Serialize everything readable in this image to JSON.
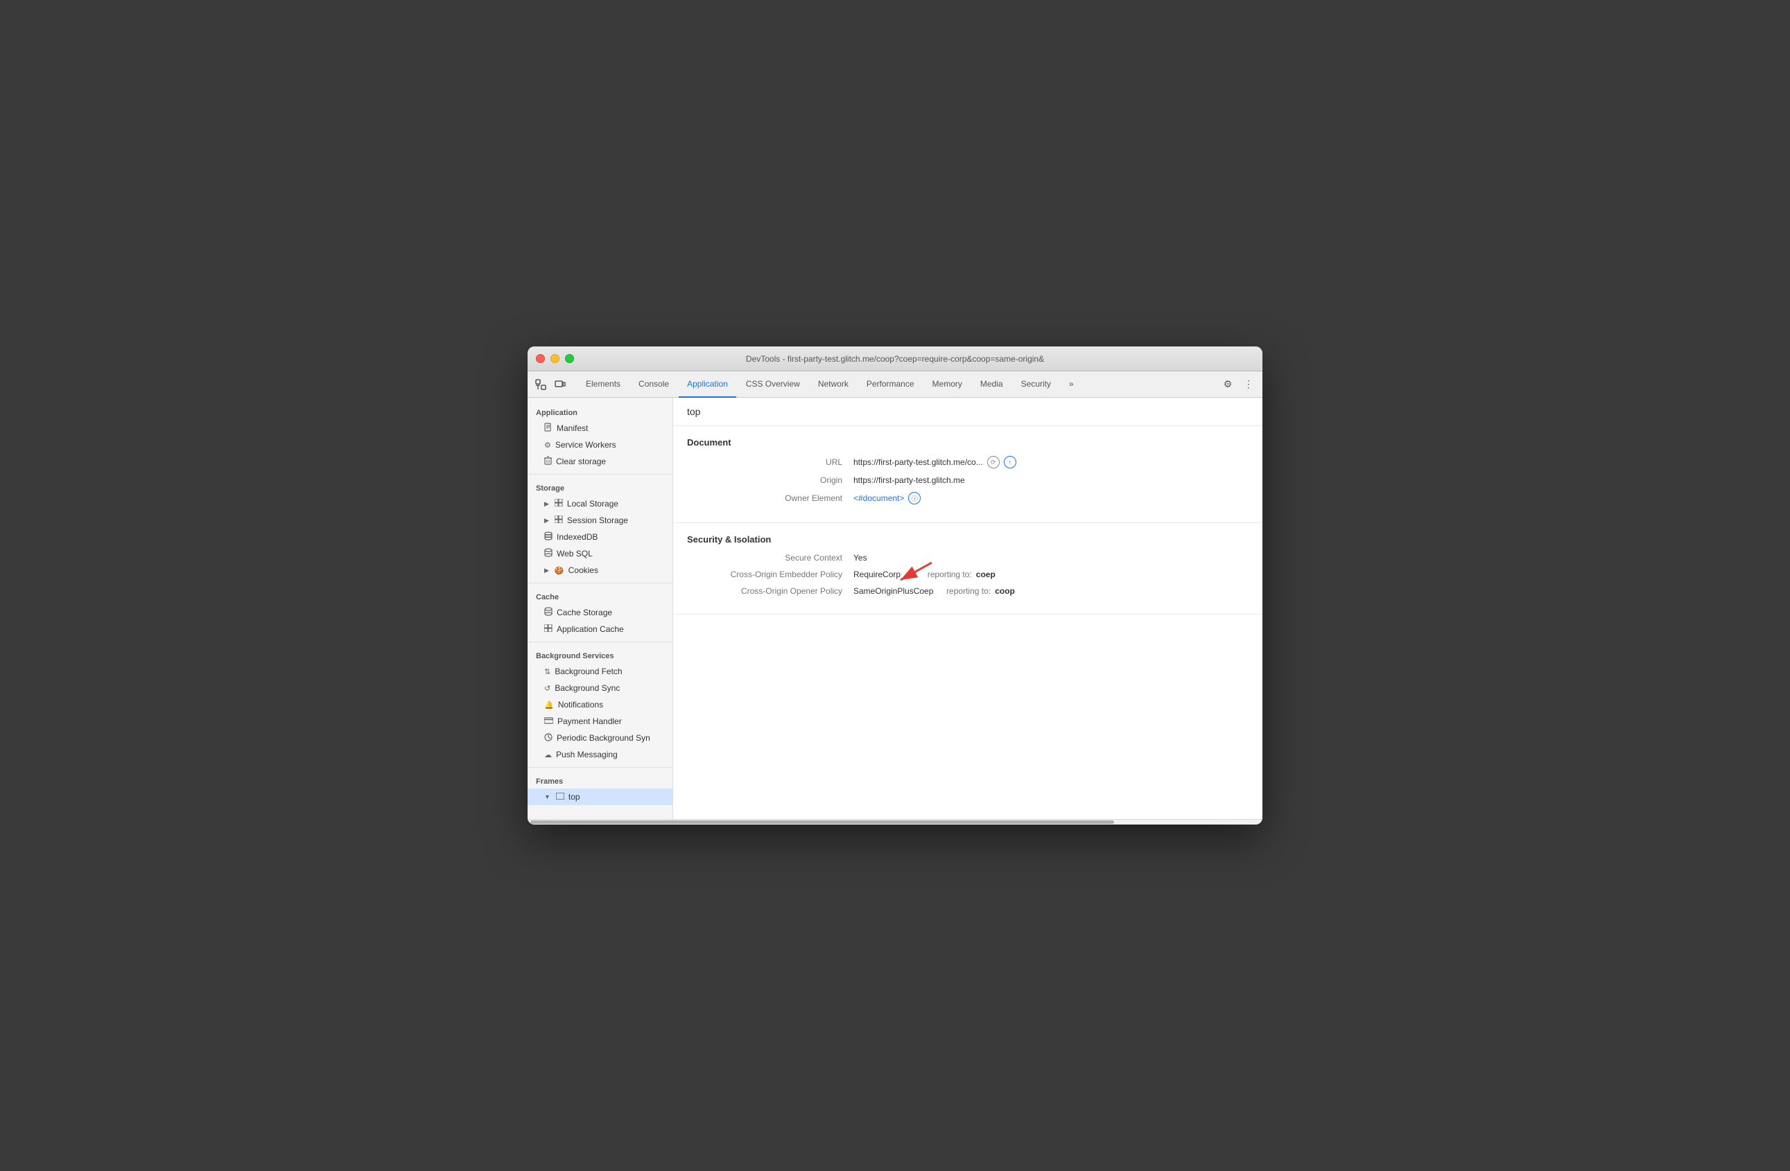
{
  "window": {
    "title": "DevTools - first-party-test.glitch.me/coop?coep=require-corp&coop=same-origin&"
  },
  "tabs": [
    {
      "id": "elements",
      "label": "Elements",
      "active": false
    },
    {
      "id": "console",
      "label": "Console",
      "active": false
    },
    {
      "id": "application",
      "label": "Application",
      "active": true
    },
    {
      "id": "css-overview",
      "label": "CSS Overview",
      "active": false
    },
    {
      "id": "network",
      "label": "Network",
      "active": false
    },
    {
      "id": "performance",
      "label": "Performance",
      "active": false
    },
    {
      "id": "memory",
      "label": "Memory",
      "active": false
    },
    {
      "id": "media",
      "label": "Media",
      "active": false
    },
    {
      "id": "security",
      "label": "Security",
      "active": false
    },
    {
      "id": "more",
      "label": "»",
      "active": false
    }
  ],
  "sidebar": {
    "sections": [
      {
        "id": "application",
        "label": "Application",
        "items": [
          {
            "id": "manifest",
            "label": "Manifest",
            "icon": "📄",
            "iconType": "file"
          },
          {
            "id": "service-workers",
            "label": "Service Workers",
            "icon": "⚙",
            "iconType": "gear"
          },
          {
            "id": "clear-storage",
            "label": "Clear storage",
            "icon": "🗑",
            "iconType": "trash"
          }
        ]
      },
      {
        "id": "storage",
        "label": "Storage",
        "items": [
          {
            "id": "local-storage",
            "label": "Local Storage",
            "icon": "▶",
            "hasArrow": true,
            "iconType": "grid"
          },
          {
            "id": "session-storage",
            "label": "Session Storage",
            "icon": "▶",
            "hasArrow": true,
            "iconType": "grid"
          },
          {
            "id": "indexeddb",
            "label": "IndexedDB",
            "iconType": "cylinder"
          },
          {
            "id": "web-sql",
            "label": "Web SQL",
            "iconType": "cylinder"
          },
          {
            "id": "cookies",
            "label": "Cookies",
            "icon": "▶",
            "hasArrow": true,
            "iconType": "cookie"
          }
        ]
      },
      {
        "id": "cache",
        "label": "Cache",
        "items": [
          {
            "id": "cache-storage",
            "label": "Cache Storage",
            "iconType": "cylinder"
          },
          {
            "id": "application-cache",
            "label": "Application Cache",
            "iconType": "grid"
          }
        ]
      },
      {
        "id": "background-services",
        "label": "Background Services",
        "items": [
          {
            "id": "background-fetch",
            "label": "Background Fetch",
            "iconType": "arrows"
          },
          {
            "id": "background-sync",
            "label": "Background Sync",
            "iconType": "sync"
          },
          {
            "id": "notifications",
            "label": "Notifications",
            "iconType": "bell"
          },
          {
            "id": "payment-handler",
            "label": "Payment Handler",
            "iconType": "card"
          },
          {
            "id": "periodic-bg-sync",
            "label": "Periodic Background Syn",
            "iconType": "clock"
          },
          {
            "id": "push-messaging",
            "label": "Push Messaging",
            "iconType": "cloud"
          }
        ]
      },
      {
        "id": "frames",
        "label": "Frames",
        "items": [
          {
            "id": "top-frame",
            "label": "top",
            "icon": "▼",
            "hasArrow": true,
            "iconType": "frame",
            "selected": true
          }
        ]
      }
    ]
  },
  "content": {
    "breadcrumb": "top",
    "document_section": {
      "title": "Document",
      "fields": [
        {
          "label": "URL",
          "value": "https://first-party-test.glitch.me/co...",
          "has_icons": true
        },
        {
          "label": "Origin",
          "value": "https://first-party-test.glitch.me",
          "has_icons": false
        },
        {
          "label": "Owner Element",
          "value": "<#document>",
          "is_link": true,
          "has_info_icon": true
        }
      ]
    },
    "security_section": {
      "title": "Security & Isolation",
      "fields": [
        {
          "label": "Secure Context",
          "value": "Yes"
        },
        {
          "label": "Cross-Origin Embedder Policy",
          "value": "RequireCorp",
          "reporting": "reporting to:",
          "reporting_value": "coep",
          "has_arrow": true
        },
        {
          "label": "Cross-Origin Opener Policy",
          "value": "SameOriginPlusCoep",
          "reporting": "reporting to:",
          "reporting_value": "coop"
        }
      ]
    }
  }
}
